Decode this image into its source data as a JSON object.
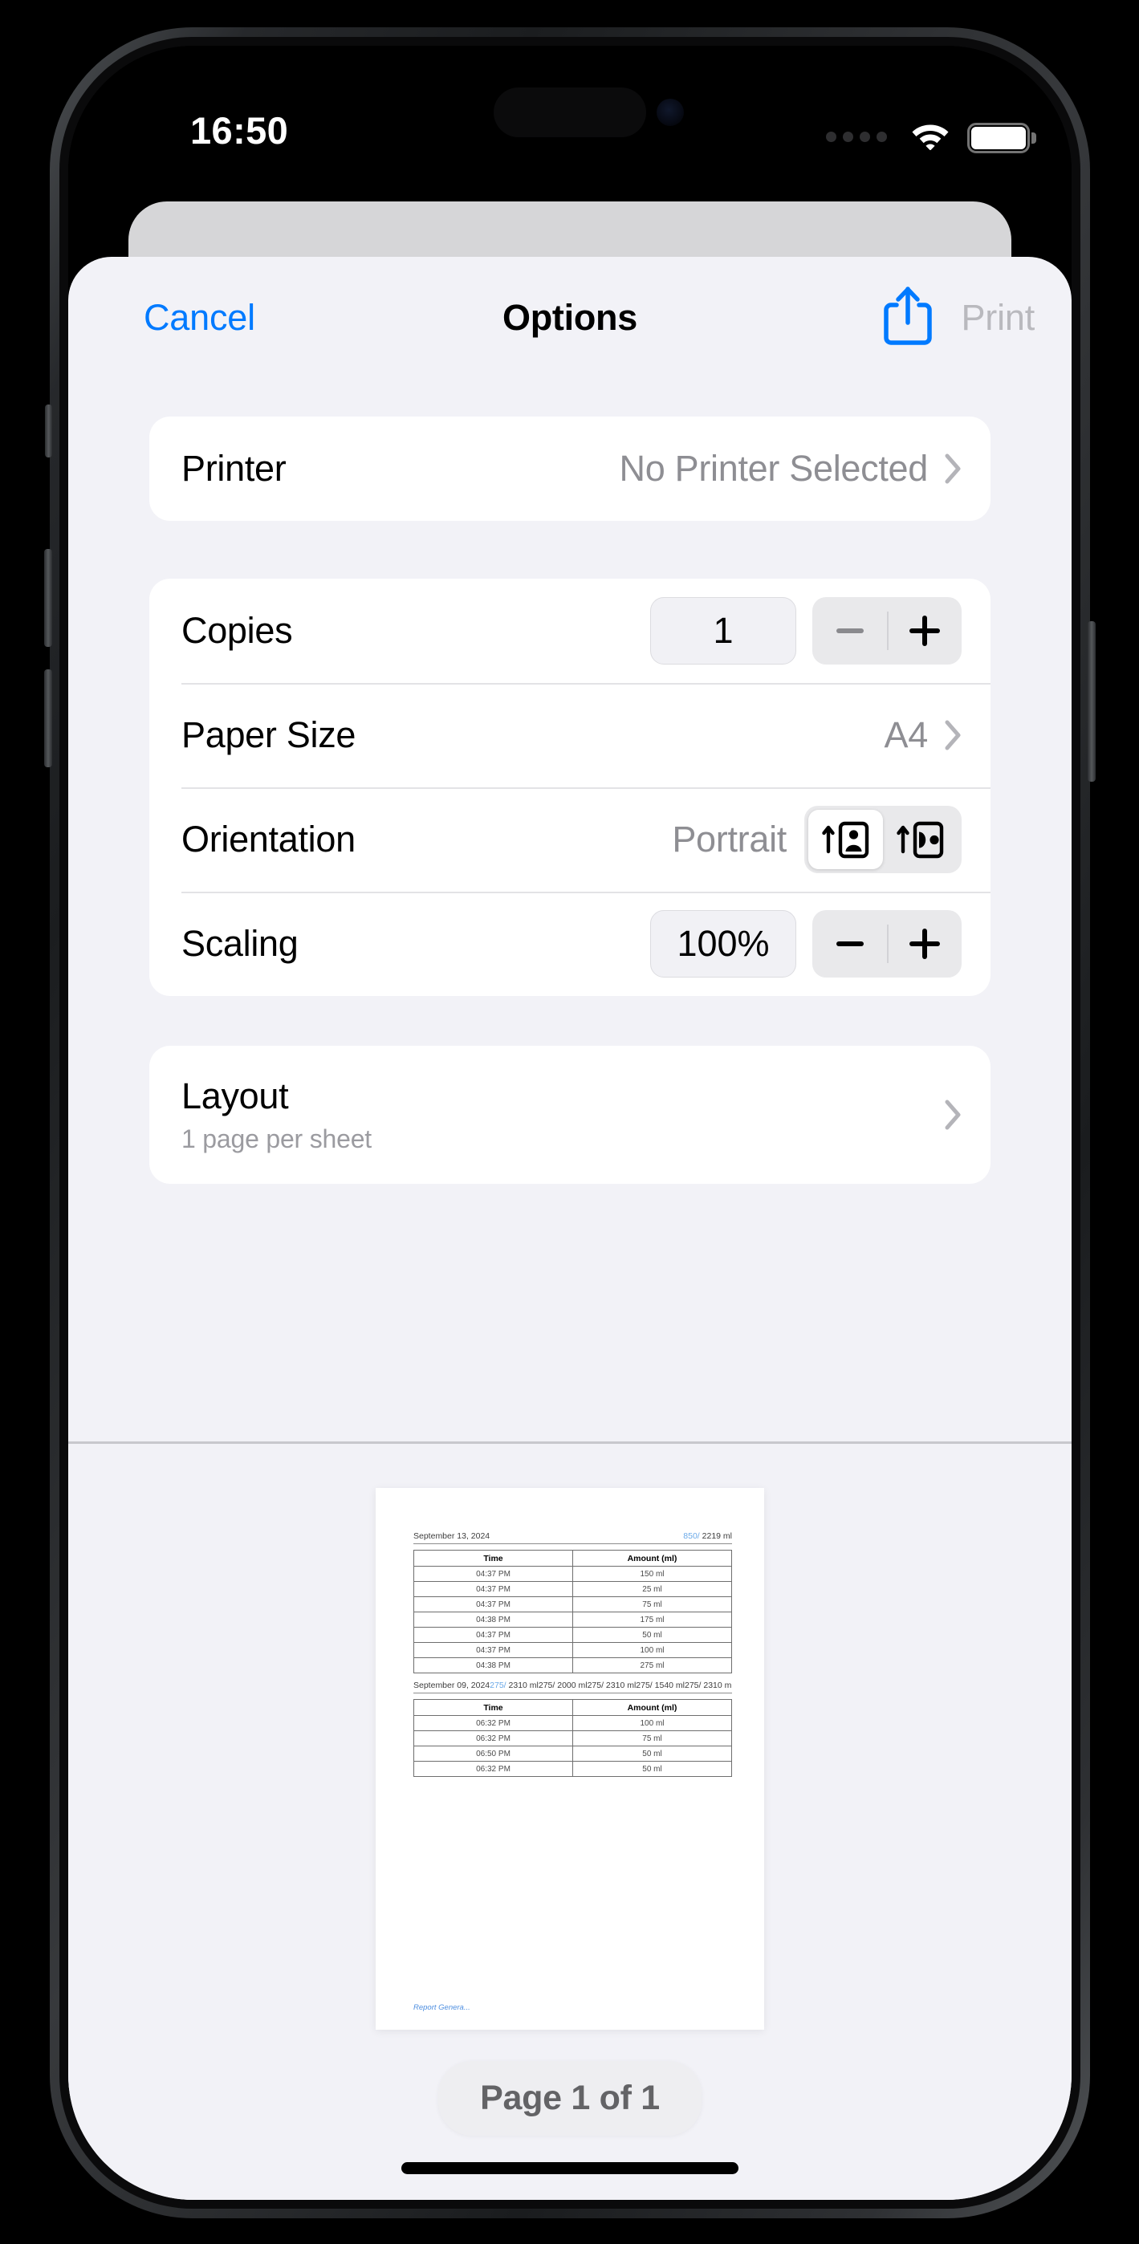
{
  "status_bar": {
    "time": "16:50",
    "cellular_icon": "cellular-dots-icon",
    "wifi_icon": "wifi-icon",
    "battery_icon": "battery-full-icon"
  },
  "header": {
    "cancel_label": "Cancel",
    "title": "Options",
    "share_icon": "share-icon",
    "print_label": "Print",
    "cancel_color": "#007aff",
    "print_color": "#b9b9be"
  },
  "printer": {
    "label": "Printer",
    "value": "No Printer Selected",
    "chevron_icon": "chevron-right-icon"
  },
  "settings": {
    "copies": {
      "label": "Copies",
      "value": "1",
      "decrement_icon": "minus-icon",
      "increment_icon": "plus-icon",
      "decrement_enabled": false,
      "increment_enabled": true
    },
    "paper_size": {
      "label": "Paper Size",
      "value": "A4",
      "chevron_icon": "chevron-right-icon"
    },
    "orientation": {
      "label": "Orientation",
      "value": "Portrait",
      "options": [
        "Portrait",
        "Landscape"
      ],
      "selected": "Portrait",
      "portrait_icon": "orientation-portrait-icon",
      "landscape_icon": "orientation-landscape-icon"
    },
    "scaling": {
      "label": "Scaling",
      "value": "100%",
      "decrement_icon": "minus-icon",
      "increment_icon": "plus-icon",
      "decrement_enabled": true,
      "increment_enabled": true
    }
  },
  "layout": {
    "title": "Layout",
    "subtitle": "1 page per sheet",
    "chevron_icon": "chevron-right-icon"
  },
  "preview": {
    "page_indicator": "Page 1 of 1",
    "document": {
      "sections": [
        {
          "date": "September 13, 2024",
          "total_fraction": "850/",
          "total_amount": " 2219 ml",
          "overflow": "",
          "columns": [
            "Time",
            "Amount (ml)"
          ],
          "rows": [
            [
              "04:37 PM",
              "150 ml"
            ],
            [
              "04:37 PM",
              "25 ml"
            ],
            [
              "04:37 PM",
              "75 ml"
            ],
            [
              "04:38 PM",
              "175 ml"
            ],
            [
              "04:37 PM",
              "50 ml"
            ],
            [
              "04:37 PM",
              "100 ml"
            ],
            [
              "04:38 PM",
              "275 ml"
            ]
          ]
        },
        {
          "date": "September 09, 2024",
          "total_fraction": "275/",
          "total_amount": " 2310 ml",
          "overflow": "275/ 2000 ml275/ 2310 ml275/ 1540 ml275/ 2310 ml275/ 2310 m",
          "columns": [
            "Time",
            "Amount (ml)"
          ],
          "rows": [
            [
              "06:32 PM",
              "100 ml"
            ],
            [
              "06:32 PM",
              "75 ml"
            ],
            [
              "06:50 PM",
              "50 ml"
            ],
            [
              "06:32 PM",
              "50 ml"
            ]
          ]
        }
      ],
      "footer": "Report Genera..."
    }
  }
}
